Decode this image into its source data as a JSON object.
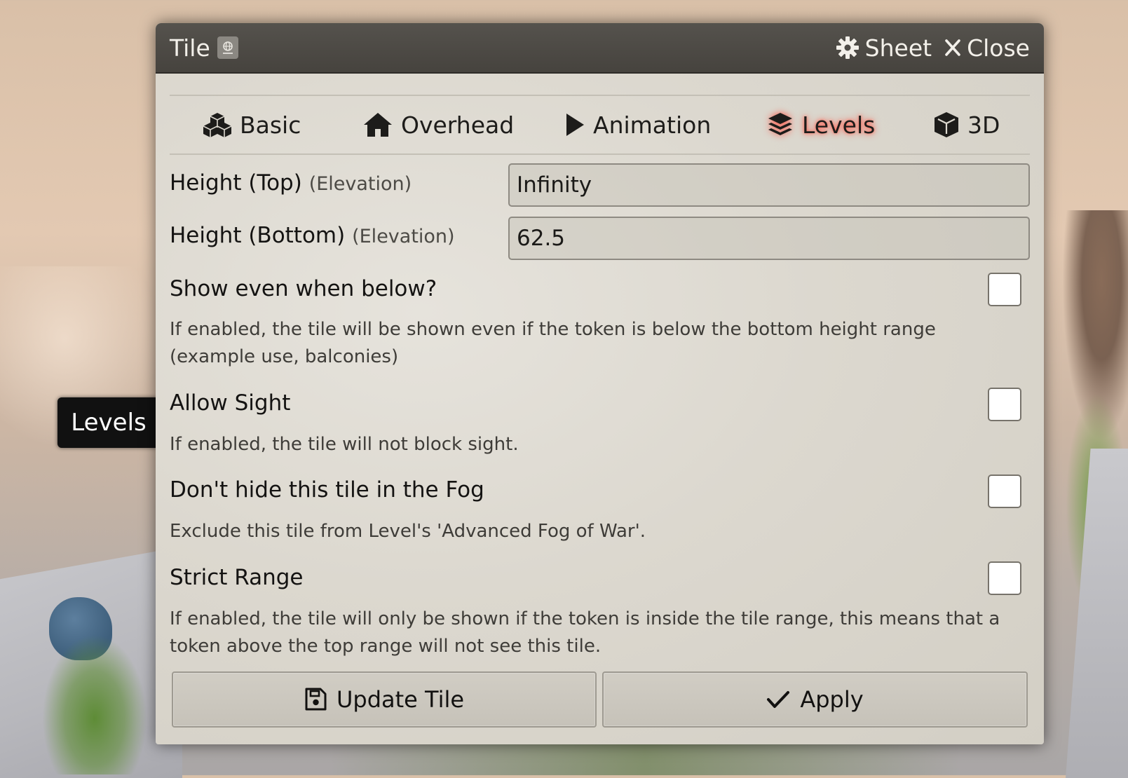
{
  "tooltip": {
    "text": "Levels"
  },
  "window": {
    "title": "Tile",
    "header_buttons": {
      "sheet": "Sheet",
      "close": "Close"
    }
  },
  "tabs": [
    {
      "label": "Basic",
      "icon": "cubes-icon"
    },
    {
      "label": "Overhead",
      "icon": "home-icon"
    },
    {
      "label": "Animation",
      "icon": "play-icon"
    },
    {
      "label": "Levels",
      "icon": "layer-group-icon",
      "active": true
    },
    {
      "label": "3D",
      "icon": "cube-icon"
    }
  ],
  "form": {
    "height_top": {
      "label": "Height (Top)",
      "hint": "(Elevation)",
      "value": "Infinity"
    },
    "height_bottom": {
      "label": "Height (Bottom)",
      "hint": "(Elevation)",
      "value": "62.5"
    },
    "show_below": {
      "label": "Show even when below?",
      "note": "If enabled, the tile will be shown even if the token is below the bottom height range (example use, balconies)",
      "checked": false
    },
    "allow_sight": {
      "label": "Allow Sight",
      "note": "If enabled, the tile will not block sight.",
      "checked": false
    },
    "no_fog_hide": {
      "label": "Don't hide this tile in the Fog",
      "note": "Exclude this tile from Level's 'Advanced Fog of War'.",
      "checked": false
    },
    "strict_range": {
      "label": "Strict Range",
      "note": "If enabled, the tile will only be shown if the token is inside the tile range, this means that a token above the top range will not see this tile.",
      "checked": false
    }
  },
  "footer": {
    "update": "Update Tile",
    "apply": "Apply"
  },
  "colors": {
    "active_tab_glow": "#ff4a3a",
    "titlebar": "#4e4b46"
  }
}
